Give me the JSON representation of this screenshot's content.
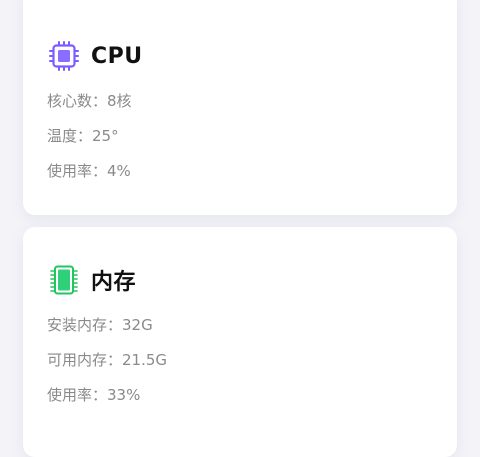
{
  "cpu": {
    "title": "CPU",
    "icon": "cpu-chip-icon",
    "icon_color": "#7c5cff",
    "rows": [
      "核心数：8核",
      "温度：25°",
      "使用率：4%"
    ]
  },
  "memory": {
    "title": "内存",
    "icon": "memory-module-icon",
    "icon_color": "#22c55e",
    "rows": [
      "安装内存：32G",
      "可用内存：21.5G",
      "使用率：33%"
    ]
  }
}
